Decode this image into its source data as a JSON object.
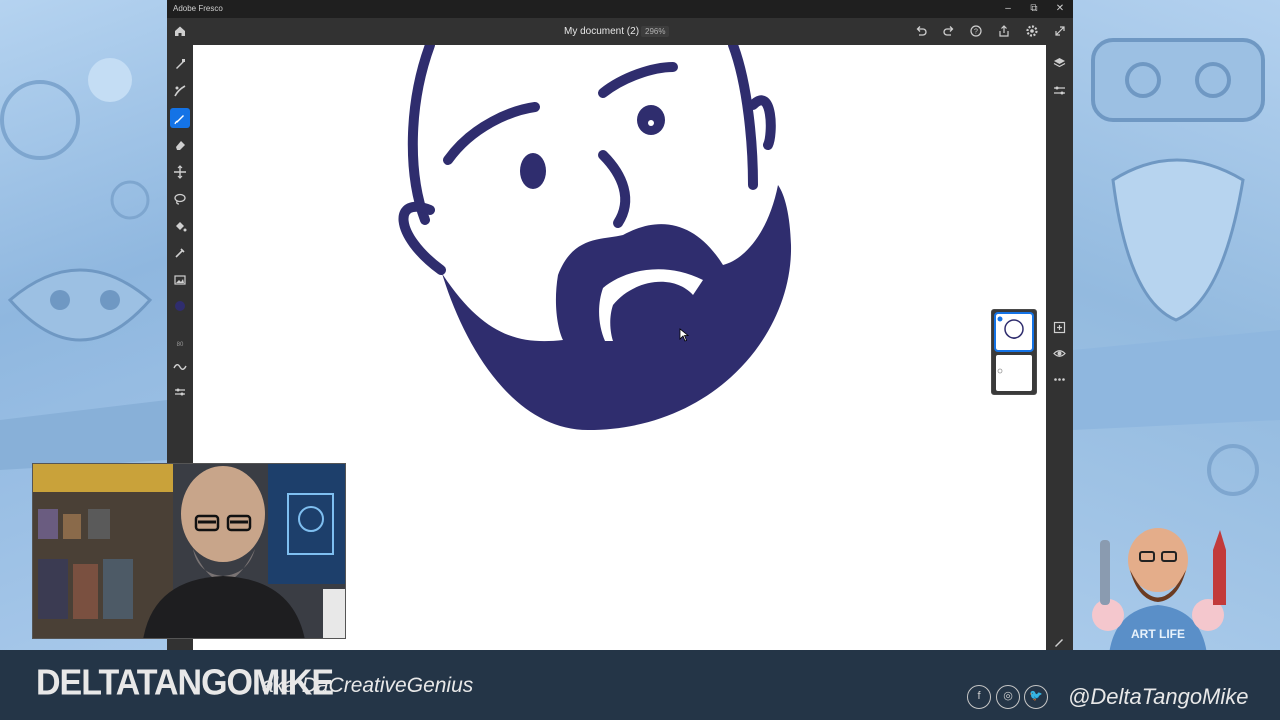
{
  "window": {
    "app_name": "Adobe Fresco",
    "controls": {
      "minimize": "–",
      "restore": "⧉",
      "close": "✕"
    }
  },
  "topbar": {
    "document_title": "My document (2)",
    "zoom_level": "296%",
    "icons": [
      "home-icon",
      "undo-icon",
      "redo-icon",
      "help-icon",
      "share-icon",
      "settings-icon",
      "fullscreen-icon"
    ]
  },
  "tools": {
    "items": [
      "pixel-brush-icon",
      "live-brush-icon",
      "vector-brush-icon",
      "eraser-icon",
      "move-icon",
      "lasso-icon",
      "fill-icon",
      "eyedropper-icon",
      "image-icon"
    ],
    "active": "vector-brush-icon",
    "brush_size_label": "80",
    "brush_color": "#2f2d6e"
  },
  "right_panel": {
    "icons": [
      "layers-icon",
      "layer-properties-icon",
      "add-layer-icon",
      "visibility-icon",
      "more-icon",
      "pen-icon"
    ]
  },
  "canvas": {
    "stroke_color": "#2f2d6e"
  },
  "footer": {
    "brand": "DELTATANGOMIKE",
    "aka": "aka DaCreativeGenius",
    "social_icons": [
      "facebook-icon",
      "instagram-icon",
      "twitter-icon"
    ],
    "social_glyphs": [
      "f",
      "◎",
      "🐦"
    ],
    "handle": "@DeltaTangoMike"
  },
  "colors": {
    "accent": "#1473e6",
    "footer_bg": "#243547",
    "backdrop": "#a9c9e8"
  }
}
